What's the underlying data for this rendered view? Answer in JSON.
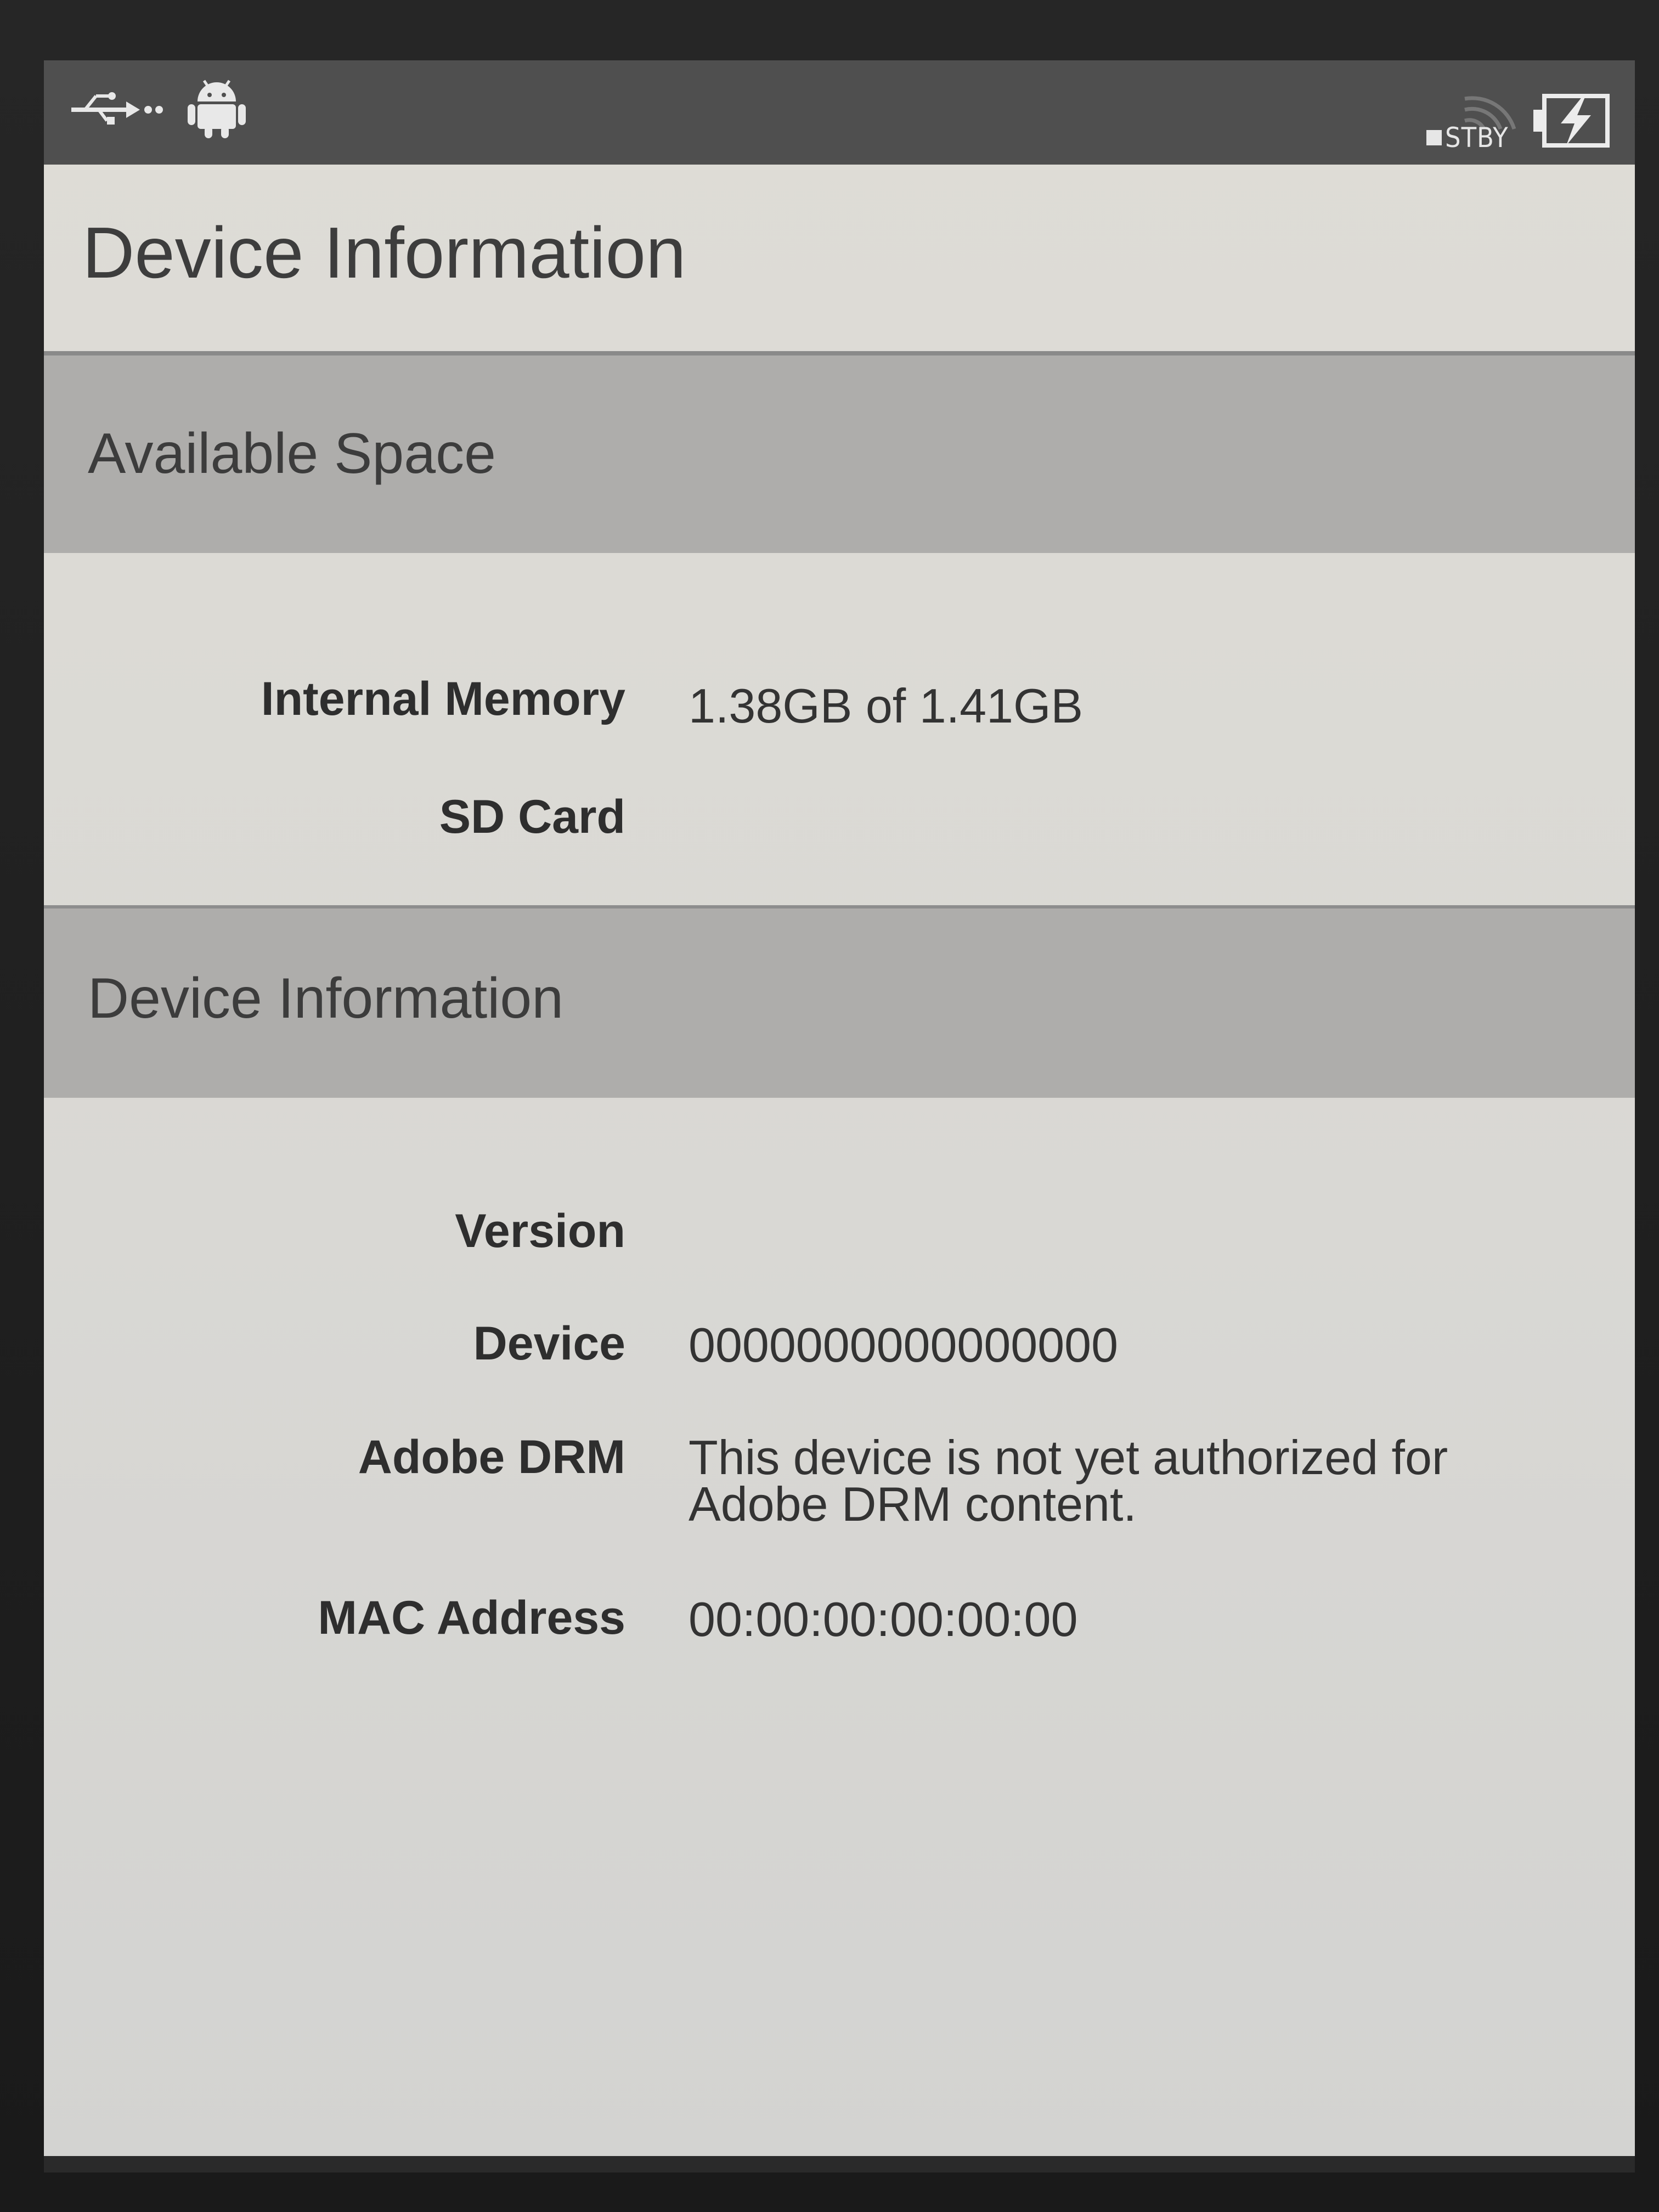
{
  "status_bar": {
    "usb_icon": "usb-icon",
    "android_icon": "android-icon",
    "wifi_icon": "wifi-icon",
    "wifi_state": "STBY",
    "battery_icon": "battery-charging-icon"
  },
  "page": {
    "title": "Device Information"
  },
  "available_space": {
    "header": "Available Space",
    "rows": [
      {
        "label": "Internal Memory",
        "value": "1.38GB of 1.41GB"
      },
      {
        "label": "SD Card",
        "value": ""
      }
    ]
  },
  "device_information": {
    "header": "Device Information",
    "rows": [
      {
        "label": "Version",
        "value": ""
      },
      {
        "label": "Device",
        "value": "0000000000000000"
      },
      {
        "label": "Adobe DRM",
        "value_line1": "This device is not yet authorized for",
        "value_line2": "Adobe DRM content."
      },
      {
        "label": "MAC Address",
        "value": "00:00:00:00:00:00"
      }
    ]
  }
}
